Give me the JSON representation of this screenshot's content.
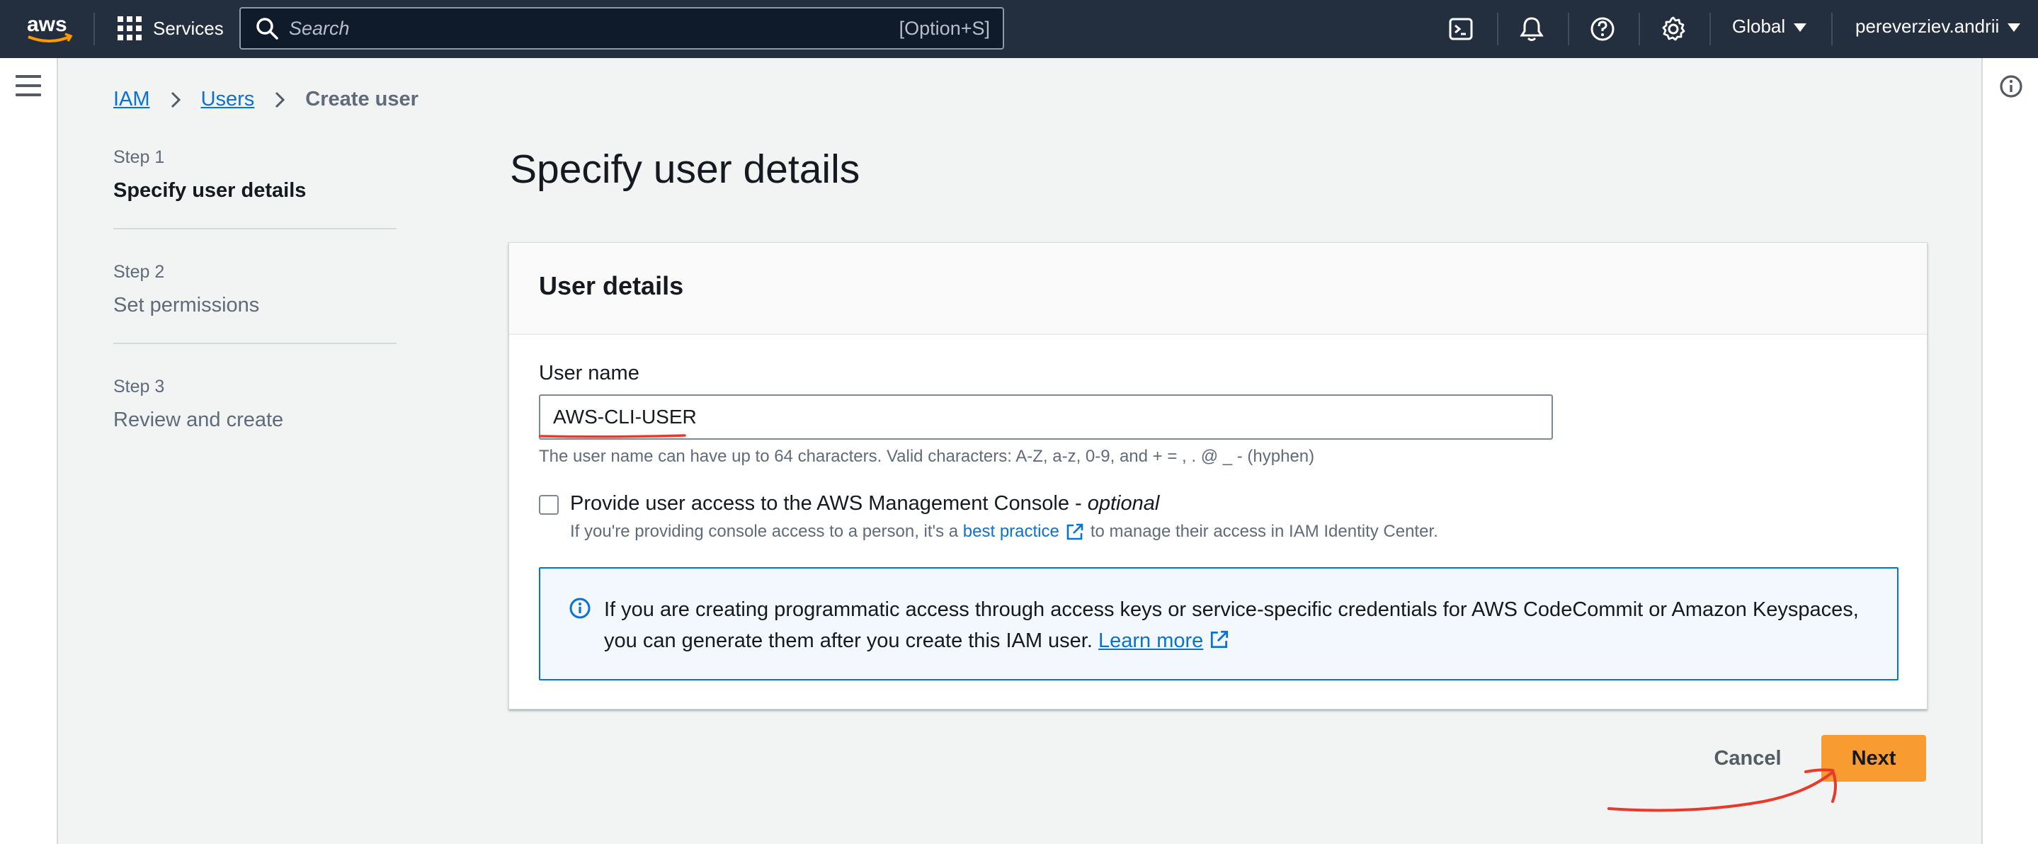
{
  "topnav": {
    "logo_text": "aws",
    "services_label": "Services",
    "search_placeholder": "Search",
    "search_shortcut": "[Option+S]",
    "region": "Global",
    "account": "pereverziev.andrii",
    "icons": [
      "cloudshell-icon",
      "bell-icon",
      "help-icon",
      "gear-icon"
    ]
  },
  "breadcrumb": {
    "items": [
      "IAM",
      "Users"
    ],
    "current": "Create user"
  },
  "steps": [
    {
      "number": "Step 1",
      "title": "Specify user details",
      "active": true
    },
    {
      "number": "Step 2",
      "title": "Set permissions",
      "active": false
    },
    {
      "number": "Step 3",
      "title": "Review and create",
      "active": false
    }
  ],
  "page_title": "Specify user details",
  "panel": {
    "title": "User details",
    "username_label": "User name",
    "username_value": "AWS-CLI-USER",
    "username_hint": "The user name can have up to 64 characters. Valid characters: A-Z, a-z, 0-9, and + = , . @ _ - (hyphen)",
    "console_label": "Provide user access to the AWS Management Console - ",
    "console_optional": "optional",
    "console_desc_pre": "If you're providing console access to a person, it's a",
    "console_desc_link": "best practice",
    "console_desc_post": "to manage their access in IAM Identity Center.",
    "alert_text": "If you are creating programmatic access through access keys or service-specific credentials for AWS CodeCommit or Amazon Keyspaces, you can generate them after you create this IAM user.",
    "alert_link": "Learn more"
  },
  "actions": {
    "cancel": "Cancel",
    "next": "Next"
  },
  "colors": {
    "nav_bg": "#232f3e",
    "link": "#0972d3",
    "primary_button": "#f89c32",
    "annotation": "#e8392b"
  }
}
